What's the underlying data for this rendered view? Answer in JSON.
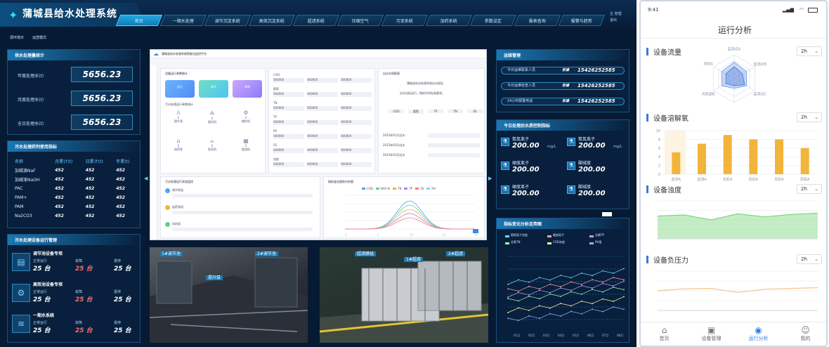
{
  "dashboard": {
    "app_title": "蒲城县给水处理系统",
    "nav_tabs": [
      "首页",
      "一期水处理",
      "调节沉淀系统",
      "高效沉淀系统",
      "超滤系统",
      "压缩空气",
      "污泥系统",
      "加药系统",
      "参数设定",
      "报表查询",
      "报警与趋势"
    ],
    "active_tab": 0,
    "user": [
      "主 管理",
      "退出"
    ],
    "sub_tabs": [
      "源环境示",
      "运营模式"
    ],
    "water_panel": {
      "title": "供水处理量统计",
      "rows": [
        {
          "label": "年度处理水(t)",
          "value": "5656.23"
        },
        {
          "label": "月度处理水(t)",
          "value": "5656.23"
        },
        {
          "label": "全日处理水(t)",
          "value": "5656.23"
        }
      ]
    },
    "chem_panel": {
      "title": "污水处理药剂使用指标",
      "headers": [
        "名称",
        "月累计(t)",
        "日累计(t)",
        "年累(t)"
      ],
      "rows": [
        [
          "加碳源NaF",
          "452",
          "452",
          "452"
        ],
        [
          "加碱液NaOH",
          "452",
          "452",
          "452"
        ],
        [
          "PAC",
          "452",
          "452",
          "452"
        ],
        [
          "PAM+",
          "452",
          "452",
          "452"
        ],
        [
          "PAM",
          "452",
          "452",
          "452"
        ],
        [
          "Na2CO3",
          "452",
          "452",
          "452"
        ]
      ]
    },
    "equip_panel": {
      "title": "污水处理设备运行管理",
      "groups": [
        {
          "name": "调节池设备专项",
          "labels": [
            "正常运行",
            "故障",
            "报停"
          ],
          "values": [
            "25 台",
            "25 台",
            "25 台"
          ]
        },
        {
          "name": "高效池设备专项",
          "labels": [
            "正常运行",
            "故障",
            "报停"
          ],
          "values": [
            "25 台",
            "25 台",
            "25 台"
          ]
        },
        {
          "name": "一期水系统",
          "labels": [
            "正常运行",
            "故障",
            "报停"
          ],
          "values": [
            "25 台",
            "25 台",
            "25 台"
          ]
        }
      ]
    },
    "screen": {
      "title": "蒲城县给水处理系统智能化监控平台",
      "section1": "设备运行参数统计",
      "section2": "污水处理运行参数统计",
      "section3": "出水水质报表",
      "section4": "污水处理运行状态监控",
      "section5": "指标变化趋势分析图",
      "tiles": [
        "运行",
        "调节",
        "高效"
      ],
      "icons": [
        "提升泵",
        "鼓风机",
        "搅拌机",
        "加药泵",
        "刮泥机",
        "超滤机"
      ],
      "icon_values": [
        "0",
        "0",
        "0",
        "0",
        "0",
        "0"
      ],
      "param_rows": [
        "COD",
        "氨氮",
        "TN",
        "TP",
        "PH",
        "SS",
        "浊度"
      ],
      "param_cells": [
        "000000",
        "000000",
        "000000",
        "000000"
      ],
      "report_lines": [
        "蒲城县给水处理系统出水报告",
        "出水达标运行，指标符合标准要求。"
      ],
      "report_cols": [
        "COD",
        "氨氮",
        "TP",
        "TN",
        "SS"
      ],
      "report_rows": [
        "2023年01月出水",
        "2023年02月出水",
        "2023年03月出水"
      ],
      "ctrl_items": [
        "调节泵组",
        "加药泵组",
        "风机组"
      ],
      "legend": [
        "COD",
        "NH3-N",
        "TN",
        "TP",
        "SS",
        "PH"
      ],
      "footer": [
        "0",
        "5",
        "10",
        "15",
        "20"
      ]
    },
    "mgr_panel": {
      "title": "运维管理",
      "rows": [
        {
          "label": "今日运维联系人员",
          "name": "张谦",
          "phone": "15426252585"
        },
        {
          "label": "今日运维检查人员",
          "name": "张谦",
          "phone": "15426252585"
        },
        {
          "label": "24小时报警电话",
          "name": "张谦",
          "phone": "15426252585"
        }
      ]
    },
    "quality_panel": {
      "title": "今日处理后水质控制指标",
      "items": [
        {
          "name": "氨氮离子",
          "value": "200.00",
          "unit": "mg/L"
        },
        {
          "name": "氨氮离子",
          "value": "200.00",
          "unit": "mg/L"
        },
        {
          "name": "硬度离子",
          "value": "200.00",
          "unit": ""
        },
        {
          "name": "酸碱度",
          "value": "200.00",
          "unit": ""
        },
        {
          "name": "硬度离子",
          "value": "200.00",
          "unit": ""
        },
        {
          "name": "酸碱度",
          "value": "200.00",
          "unit": ""
        }
      ]
    },
    "trend_panel": {
      "title": "指标变化分析走势图",
      "legend": [
        "氨氮离子浓度",
        "硬度离子",
        "总磷TP",
        "总氮TN",
        "COD浓度",
        "PH值"
      ],
      "x": [
        "01月",
        "02月",
        "03月",
        "04月",
        "05月",
        "06月",
        "07月",
        "08月"
      ]
    },
    "scene_labels": [
      "1#调节池",
      "提升泵",
      "2#调节池",
      "超滤膜组",
      "1#超滤",
      "2#超滤"
    ]
  },
  "phone": {
    "status_time": "9:41",
    "title": "运行分析",
    "sections": [
      {
        "title": "设备流量",
        "select": "2h"
      },
      {
        "title": "设备溶解氧",
        "select": "2h"
      },
      {
        "title": "设备浊度",
        "select": "2h"
      },
      {
        "title": "设备负压力",
        "select": "2h"
      }
    ],
    "radar_labels": [
      "监测点A",
      "监测点B",
      "监测点C",
      "风机组",
      "风机组B",
      "风机A"
    ],
    "bar_categories": [
      "监测A",
      "监测A",
      "风机A",
      "风机A",
      "风机A",
      "风机A"
    ],
    "bar_yticks": [
      "10",
      "8",
      "6",
      "4",
      "2",
      "0"
    ],
    "nav": [
      {
        "label": "首页",
        "icon": "home-icon"
      },
      {
        "label": "设备管理",
        "icon": "device-icon"
      },
      {
        "label": "运行分析",
        "icon": "analysis-icon"
      },
      {
        "label": "我的",
        "icon": "user-icon"
      }
    ],
    "active_nav": 2
  },
  "chart_data": [
    {
      "type": "bar",
      "title": "设备溶解氧",
      "categories": [
        "监测A",
        "监测A",
        "风机A",
        "风机A",
        "风机A",
        "风机A"
      ],
      "values": [
        5,
        7,
        9,
        8,
        8,
        6
      ],
      "ylim": [
        0,
        10
      ],
      "colors": [
        "#f3b43b"
      ]
    },
    {
      "type": "area",
      "title": "设备浊度",
      "x": [
        0,
        1,
        2,
        3,
        4,
        5,
        6
      ],
      "values": [
        6,
        6.3,
        5,
        6.6,
        5.8,
        6.4,
        6.8
      ],
      "ylim": [
        0,
        10
      ],
      "colors": [
        "#7fd67f"
      ]
    },
    {
      "type": "line",
      "title": "设备负压力",
      "x": [
        0,
        1,
        2,
        3,
        4,
        5,
        6
      ],
      "values": [
        5,
        5.5,
        5.6,
        4.6,
        5.4,
        5.6,
        5.8
      ],
      "ylim": [
        0,
        10
      ],
      "colors": [
        "#f5c38b"
      ]
    },
    {
      "type": "radar",
      "title": "设备流量",
      "categories": [
        "监测点A",
        "监测点B",
        "监测点C",
        "风机组",
        "风机组B",
        "风机A"
      ],
      "series": [
        {
          "values": [
            7,
            6,
            6,
            4,
            6,
            6
          ]
        },
        {
          "values": [
            5,
            4,
            5,
            3,
            4,
            4
          ]
        }
      ],
      "ylim": [
        0,
        10
      ]
    }
  ]
}
